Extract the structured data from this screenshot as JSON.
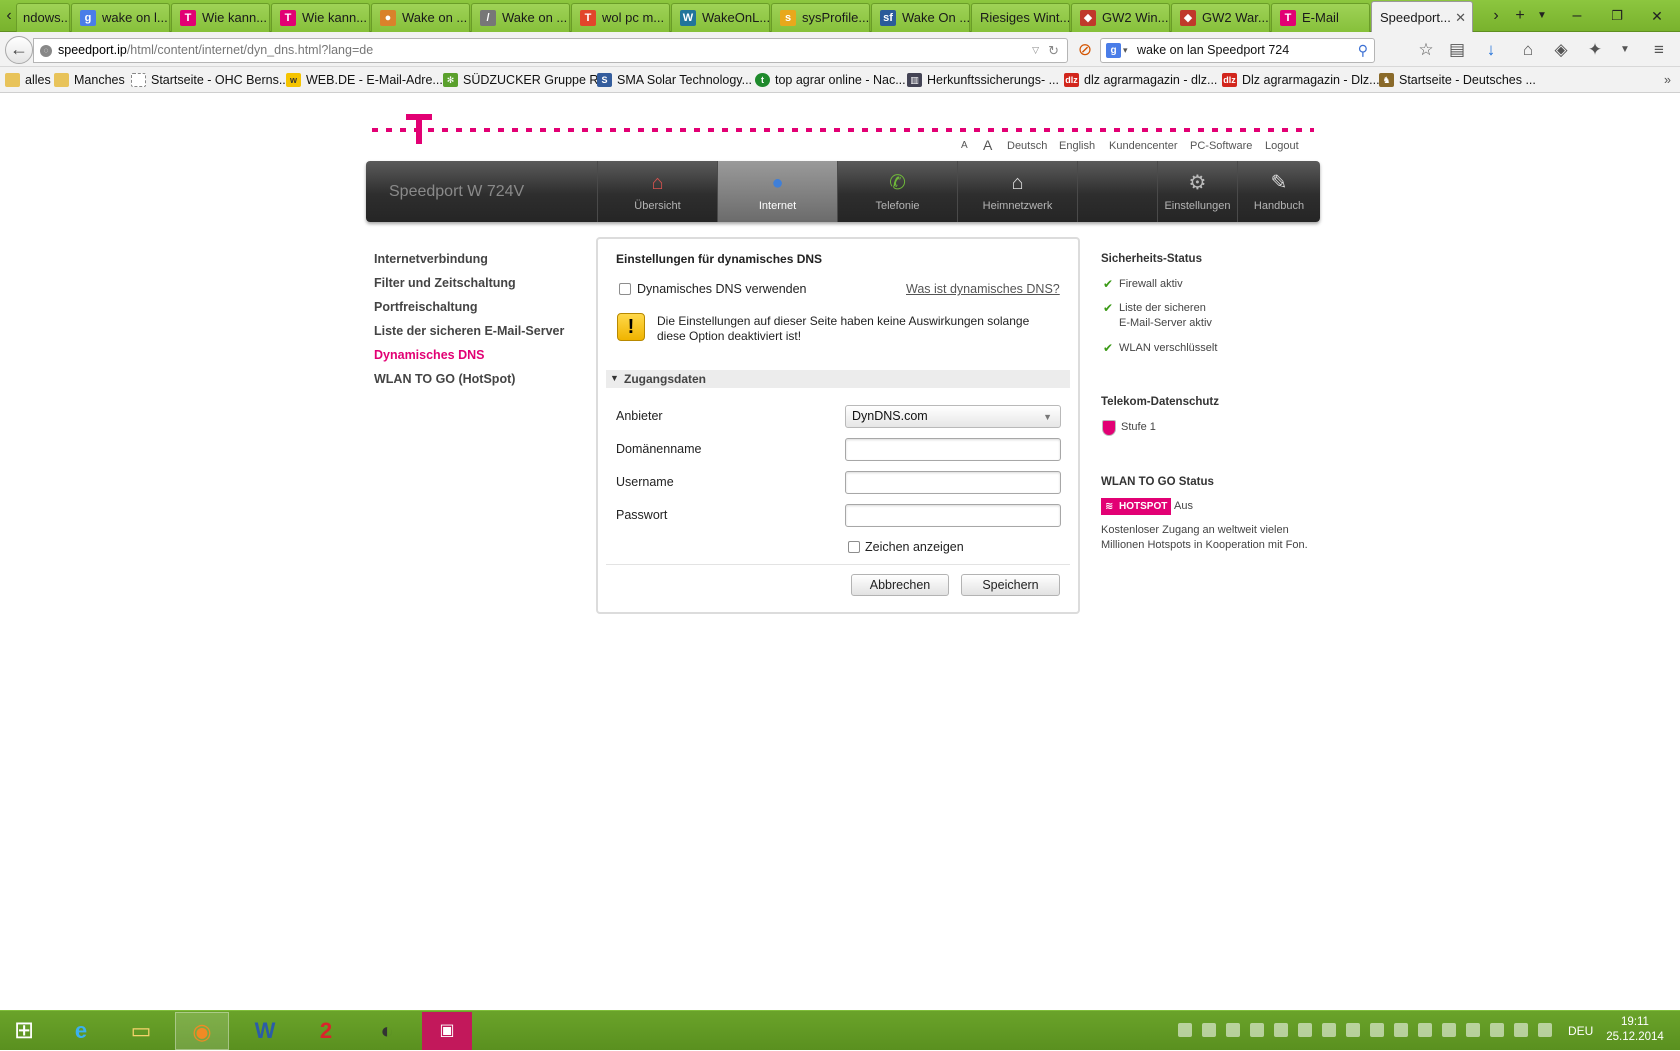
{
  "browser": {
    "tabs": [
      {
        "label": "ndows..."
      },
      {
        "label": "wake on l..."
      },
      {
        "label": "Wie kann..."
      },
      {
        "label": "Wie kann..."
      },
      {
        "label": "Wake on ..."
      },
      {
        "label": "Wake on ..."
      },
      {
        "label": "wol pc m..."
      },
      {
        "label": "WakeOnL..."
      },
      {
        "label": "sysProfile..."
      },
      {
        "label": "Wake On ..."
      },
      {
        "label": "Riesiges Wint..."
      },
      {
        "label": "GW2 Win..."
      },
      {
        "label": "GW2 War..."
      },
      {
        "label": "E-Mail"
      },
      {
        "label": "Speedport..."
      }
    ],
    "url_host": "speedport.ip",
    "url_path": "/html/content/internet/dyn_dns.html?lang=de",
    "search_value": "wake on lan Speedport 724",
    "bookmarks": [
      {
        "label": "alles"
      },
      {
        "label": "Manches"
      },
      {
        "label": "Startseite - OHC Berns..."
      },
      {
        "label": "WEB.DE - E-Mail-Adre..."
      },
      {
        "label": "SÜDZUCKER Gruppe R..."
      },
      {
        "label": "SMA Solar Technology..."
      },
      {
        "label": "top agrar online - Nac..."
      },
      {
        "label": "Herkunftssicherungs- ..."
      },
      {
        "label": "dlz agrarmagazin - dlz..."
      },
      {
        "label": "Dlz agrarmagazin - Dlz..."
      },
      {
        "label": "Startseite - Deutsches ..."
      }
    ]
  },
  "page": {
    "toplinks": {
      "font_small": "A",
      "font_large": "A",
      "deutsch": "Deutsch",
      "english": "English",
      "kundencenter": "Kundencenter",
      "pc_software": "PC-Software",
      "logout": "Logout"
    },
    "brand": "Speedport W 724V",
    "nav": [
      {
        "label": "Übersicht"
      },
      {
        "label": "Internet"
      },
      {
        "label": "Telefonie"
      },
      {
        "label": "Heimnetzwerk"
      },
      {
        "label": "Einstellungen"
      },
      {
        "label": "Handbuch"
      }
    ],
    "sidebar": [
      {
        "label": "Internetverbindung"
      },
      {
        "label": "Filter und Zeitschaltung"
      },
      {
        "label": "Portfreischaltung"
      },
      {
        "label": "Liste der sicheren E-Mail-Server"
      },
      {
        "label": "Dynamisches DNS"
      },
      {
        "label": "WLAN TO GO (HotSpot)"
      }
    ],
    "form": {
      "title": "Einstellungen für dynamisches DNS",
      "use_dns_label": "Dynamisches DNS verwenden",
      "help_link": "Was ist dynamisches DNS?",
      "warning_line1": "Die Einstellungen auf dieser Seite haben keine Auswirkungen solange",
      "warning_line2": "diese Option deaktiviert ist!",
      "section": "Zugangsdaten",
      "provider_label": "Anbieter",
      "provider_value": "DynDNS.com",
      "domain_label": "Domänenname",
      "username_label": "Username",
      "password_label": "Passwort",
      "show_chars_label": "Zeichen anzeigen",
      "cancel": "Abbrechen",
      "save": "Speichern"
    },
    "status": {
      "security_title": "Sicherheits-Status",
      "firewall": "Firewall aktiv",
      "email_line1": "Liste der sicheren",
      "email_line2": "E-Mail-Server aktiv",
      "wlan": "WLAN verschlüsselt",
      "privacy_title": "Telekom-Datenschutz",
      "privacy_level": "Stufe 1",
      "wlan_togo_title": "WLAN TO GO Status",
      "hotspot_badge": "HOTSPOT",
      "hotspot_state": "Aus",
      "hotspot_desc1": "Kostenloser Zugang an weltweit vielen",
      "hotspot_desc2": "Millionen Hotspots in Kooperation mit Fon."
    }
  },
  "taskbar": {
    "language": "DEU",
    "time": "19:11",
    "date": "25.12.2014"
  },
  "colors": {
    "telekom_magenta": "#e20074",
    "browser_green": "#8cc63f"
  }
}
